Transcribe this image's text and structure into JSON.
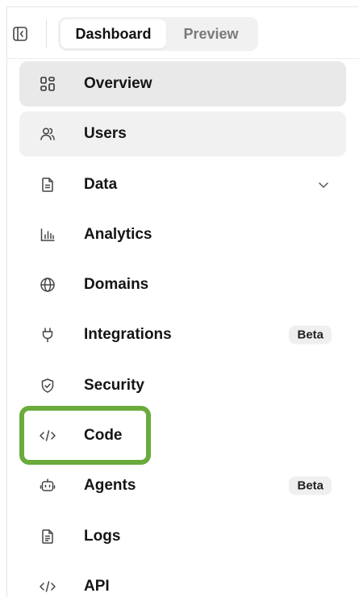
{
  "tabs": [
    {
      "label": "Dashboard",
      "active": true
    },
    {
      "label": "Preview",
      "active": false
    }
  ],
  "nav": [
    {
      "label": "Overview",
      "icon": "grid-icon",
      "state": "selected"
    },
    {
      "label": "Users",
      "icon": "users-icon",
      "state": "hover"
    },
    {
      "label": "Data",
      "icon": "document-icon",
      "expandable": true
    },
    {
      "label": "Analytics",
      "icon": "bar-chart-icon"
    },
    {
      "label": "Domains",
      "icon": "globe-icon"
    },
    {
      "label": "Integrations",
      "icon": "plug-icon",
      "badge": "Beta"
    },
    {
      "label": "Security",
      "icon": "shield-icon"
    },
    {
      "label": "Code",
      "icon": "code-icon",
      "highlighted": true
    },
    {
      "label": "Agents",
      "icon": "robot-icon",
      "badge": "Beta"
    },
    {
      "label": "Logs",
      "icon": "log-icon"
    },
    {
      "label": "API",
      "icon": "code-icon"
    }
  ],
  "colors": {
    "highlight": "#6aab3c",
    "selected_bg": "#e9e9e9",
    "hover_bg": "#f1f1f1"
  }
}
